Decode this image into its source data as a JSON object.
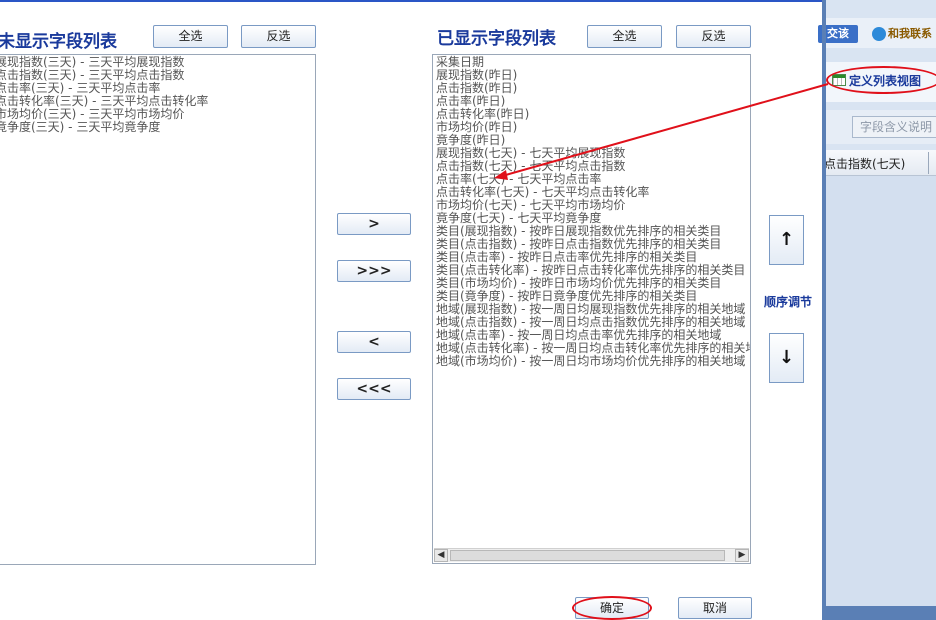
{
  "left": {
    "title": "未显示字段列表",
    "select_all": "全选",
    "invert": "反选",
    "items": [
      "展现指数(三天) - 三天平均展现指数",
      "点击指数(三天) - 三天平均点击指数",
      "点击率(三天) - 三天平均点击率",
      "点击转化率(三天) - 三天平均点击转化率",
      "市场均价(三天) - 三天平均市场均价",
      "竟争度(三天) - 三天平均竟争度"
    ]
  },
  "right": {
    "title": "已显示字段列表",
    "select_all": "全选",
    "invert": "反选",
    "items": [
      "采集日期",
      "展现指数(昨日)",
      "点击指数(昨日)",
      "点击率(昨日)",
      "点击转化率(昨日)",
      "市场均价(昨日)",
      "竟争度(昨日)",
      "展现指数(七天) - 七天平均展现指数",
      "点击指数(七天) - 七天平均点击指数",
      "点击率(七天) - 七天平均点击率",
      "点击转化率(七天) - 七天平均点击转化率",
      "市场均价(七天) - 七天平均市场均价",
      "竟争度(七天) - 七天平均竟争度",
      "类目(展现指数) - 按昨日展现指数优先排序的相关类目",
      "类目(点击指数) - 按昨日点击指数优先排序的相关类目",
      "类目(点击率) - 按昨日点击率优先排序的相关类目",
      "类目(点击转化率) - 按昨日点击转化率优先排序的相关类目",
      "类目(市场均价) - 按昨日市场均价优先排序的相关类目",
      "类目(竟争度) - 按昨日竟争度优先排序的相关类目",
      "地域(展现指数) - 按一周日均展现指数优先排序的相关地域",
      "地域(点击指数) - 按一周日均点击指数优先排序的相关地域",
      "地域(点击率) - 按一周日均点击率优先排序的相关地域",
      "地域(点击转化率) - 按一周日均点击转化率优先排序的相关地域",
      "地域(市场均价) - 按一周日均市场均价优先排序的相关地域"
    ]
  },
  "transfer": {
    "move_right": ">",
    "move_all_right": ">>>",
    "move_left": "<",
    "move_all_left": "<<<"
  },
  "order": {
    "up": "↑",
    "down": "↓",
    "label": "顺序调节"
  },
  "footer": {
    "ok": "确定",
    "cancel": "取消"
  },
  "background_app": {
    "button1": "交该",
    "contact": "和我联系",
    "define_view": "定义列表视图",
    "field_help": "字段含义说明",
    "column_header": "点击指数(七天)"
  },
  "colors": {
    "title_blue": "#1a3a9c",
    "annotation_red": "#e0101a"
  }
}
